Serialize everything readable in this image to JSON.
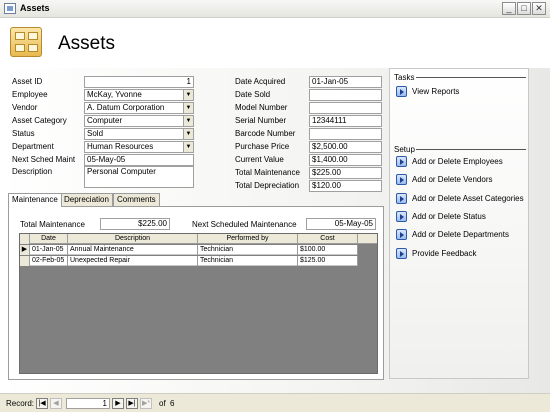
{
  "window": {
    "title": "Assets"
  },
  "header": {
    "title": "Assets"
  },
  "left_fields": [
    {
      "label": "Asset ID",
      "value": "1",
      "align": "right",
      "combo": false
    },
    {
      "label": "Employee",
      "value": "McKay, Yvonne",
      "combo": true
    },
    {
      "label": "Vendor",
      "value": "A. Datum Corporation",
      "combo": true
    },
    {
      "label": "Asset Category",
      "value": "Computer",
      "combo": true
    },
    {
      "label": "Status",
      "value": "Sold",
      "combo": true
    },
    {
      "label": "Department",
      "value": "Human Resources",
      "combo": true
    },
    {
      "label": "Next Sched Maint",
      "value": "05-May-05",
      "combo": false
    }
  ],
  "description": {
    "label": "Description",
    "value": "Personal Computer"
  },
  "right_fields": [
    {
      "label": "Date Acquired",
      "value": "01-Jan-05"
    },
    {
      "label": "Date Sold",
      "value": ""
    },
    {
      "label": "Model Number",
      "value": ""
    },
    {
      "label": "Serial Number",
      "value": "12344111"
    },
    {
      "label": "Barcode Number",
      "value": ""
    },
    {
      "label": "Purchase Price",
      "value": "$2,500.00"
    },
    {
      "label": "Current Value",
      "value": "$1,400.00"
    },
    {
      "label": "Total Maintenance",
      "value": "$225.00"
    },
    {
      "label": "Total Depreciation",
      "value": "$120.00"
    }
  ],
  "tabs": [
    "Maintenance",
    "Depreciation",
    "Comments"
  ],
  "maintenance": {
    "total_label": "Total Maintenance",
    "total_value": "$225.00",
    "next_label": "Next Scheduled Maintenance",
    "next_value": "05-May-05",
    "columns": [
      "Date",
      "Description",
      "Performed by",
      "Cost"
    ],
    "rows": [
      [
        "01-Jan-05",
        "Annual Maintenance",
        "Technician",
        "$100.00"
      ],
      [
        "02-Feb-05",
        "Unexpected Repair",
        "Technician",
        "$125.00"
      ]
    ]
  },
  "side": {
    "tasks_title": "Tasks",
    "tasks": [
      "View Reports"
    ],
    "setup_title": "Setup",
    "setup": [
      "Add or Delete Employees",
      "Add or Delete Vendors",
      "Add or Delete Asset Categories",
      "Add or Delete Status",
      "Add or Delete Departments",
      "Provide Feedback"
    ]
  },
  "navigation": {
    "label": "Record:",
    "current": "1",
    "of_label": "of",
    "total": "6"
  },
  "icons": [
    "app-icon",
    "assets-icon",
    "chevron-down-icon",
    "arrow-right-icon",
    "first-record-icon",
    "prev-record-icon",
    "next-record-icon",
    "last-record-icon",
    "new-record-icon",
    "minimize-icon",
    "maximize-icon",
    "close-icon"
  ]
}
